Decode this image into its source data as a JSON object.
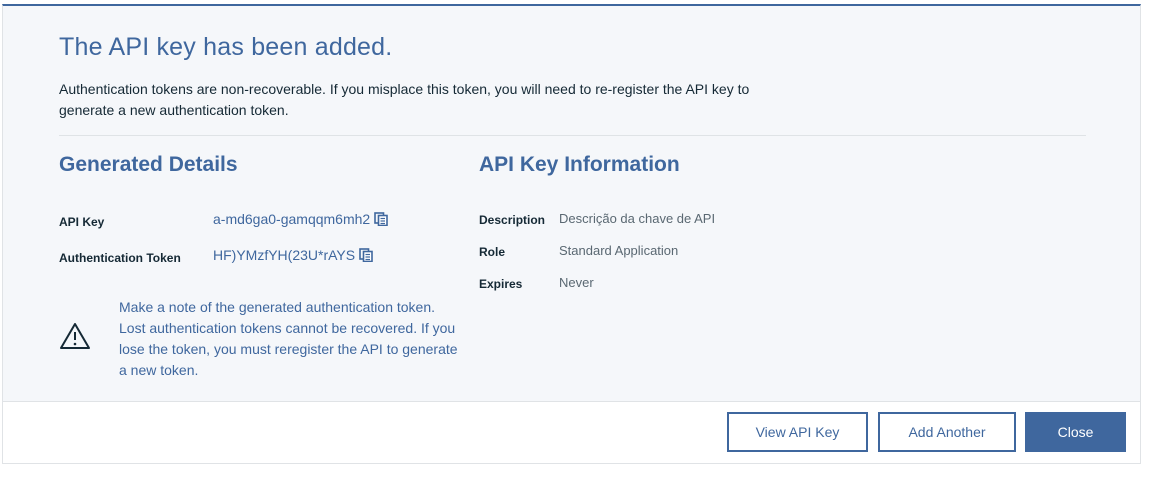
{
  "modal": {
    "title": "The API key has been added.",
    "description": "Authentication tokens are non-recoverable. If you misplace this token, you will need to re-register the API key to generate a new authentication token."
  },
  "generated_details": {
    "heading": "Generated Details",
    "api_key_label": "API Key",
    "api_key_value": "a-md6ga0-gamqqm6mh2",
    "auth_token_label": "Authentication Token",
    "auth_token_value": "HF)YMzfYH(23U*rAYS",
    "copy_icon": "copy-icon"
  },
  "warning": {
    "icon": "warning-triangle-icon",
    "text": "Make a note of the generated authentication token. Lost authentication tokens cannot be recovered. If you lose the token, you must reregister the API to generate a new token."
  },
  "api_key_information": {
    "heading": "API Key Information",
    "description_label": "Description",
    "description_value": "Descrição da chave de API",
    "role_label": "Role",
    "role_value": "Standard Application",
    "expires_label": "Expires",
    "expires_value": "Never"
  },
  "footer": {
    "view_api_key_label": "View API Key",
    "add_another_label": "Add Another",
    "close_label": "Close"
  },
  "colors": {
    "accent": "#3f679e",
    "text": "#152935",
    "muted": "#5a6872",
    "panel_bg": "#f5f7fa"
  }
}
